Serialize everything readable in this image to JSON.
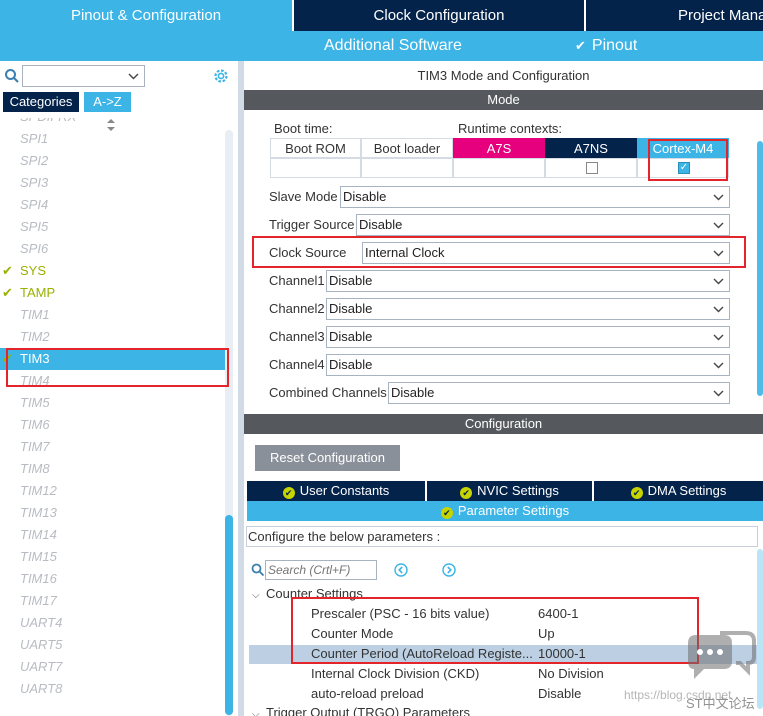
{
  "tabs": {
    "pinout": "Pinout & Configuration",
    "clock": "Clock Configuration",
    "project": "Project Mana"
  },
  "subbar": {
    "additional": "Additional Software",
    "pinout": "Pinout"
  },
  "left": {
    "search_value": "",
    "categories_tab": "Categories",
    "az_tab": "A->Z",
    "items": [
      {
        "label": "SPDIFRX",
        "state": "disabled"
      },
      {
        "label": "SPI1",
        "state": "disabled"
      },
      {
        "label": "SPI2",
        "state": "disabled"
      },
      {
        "label": "SPI3",
        "state": "disabled"
      },
      {
        "label": "SPI4",
        "state": "disabled"
      },
      {
        "label": "SPI5",
        "state": "disabled"
      },
      {
        "label": "SPI6",
        "state": "disabled"
      },
      {
        "label": "SYS",
        "state": "ok"
      },
      {
        "label": "TAMP",
        "state": "ok"
      },
      {
        "label": "TIM1",
        "state": "disabled"
      },
      {
        "label": "TIM2",
        "state": "disabled"
      },
      {
        "label": "TIM3",
        "state": "selected"
      },
      {
        "label": "TIM4",
        "state": "disabled"
      },
      {
        "label": "TIM5",
        "state": "disabled"
      },
      {
        "label": "TIM6",
        "state": "disabled"
      },
      {
        "label": "TIM7",
        "state": "disabled"
      },
      {
        "label": "TIM8",
        "state": "disabled"
      },
      {
        "label": "TIM12",
        "state": "disabled"
      },
      {
        "label": "TIM13",
        "state": "disabled"
      },
      {
        "label": "TIM14",
        "state": "disabled"
      },
      {
        "label": "TIM15",
        "state": "disabled"
      },
      {
        "label": "TIM16",
        "state": "disabled"
      },
      {
        "label": "TIM17",
        "state": "disabled"
      },
      {
        "label": "UART4",
        "state": "disabled"
      },
      {
        "label": "UART5",
        "state": "disabled"
      },
      {
        "label": "UART7",
        "state": "disabled"
      },
      {
        "label": "UART8",
        "state": "disabled"
      }
    ]
  },
  "right": {
    "title": "TIM3 Mode and Configuration",
    "mode_header": "Mode",
    "boot_time": "Boot time:",
    "runtime_contexts": "Runtime contexts:",
    "boot_rom": "Boot ROM",
    "boot_loader": "Boot loader",
    "ctx_a7s": "A7S",
    "ctx_a7ns": "A7NS",
    "ctx_m4": "Cortex-M4",
    "fields": [
      {
        "label": "Slave Mode",
        "value": "Disable"
      },
      {
        "label": "Trigger Source",
        "value": "Disable"
      },
      {
        "label": "Clock Source",
        "value": "Internal Clock"
      },
      {
        "label": "Channel1",
        "value": "Disable"
      },
      {
        "label": "Channel2",
        "value": "Disable"
      },
      {
        "label": "Channel3",
        "value": "Disable"
      },
      {
        "label": "Channel4",
        "value": "Disable"
      },
      {
        "label": "Combined Channels",
        "value": "Disable"
      }
    ],
    "config_header": "Configuration",
    "reset_button": "Reset Configuration",
    "nav": {
      "user_constants": "User Constants",
      "nvic": "NVIC Settings",
      "dma": "DMA Settings",
      "parameter": "Parameter Settings"
    },
    "configure_text": "Configure the below parameters :",
    "search_placeholder": "Search (Crtl+F)",
    "group_counter": "Counter Settings",
    "params": [
      {
        "name": "Prescaler (PSC - 16 bits value)",
        "value": "6400-1"
      },
      {
        "name": "Counter Mode",
        "value": "Up"
      },
      {
        "name": "Counter Period (AutoReload Registe...",
        "value": "10000-1"
      },
      {
        "name": "Internal Clock Division (CKD)",
        "value": "No Division"
      },
      {
        "name": "auto-reload preload",
        "value": "Disable"
      }
    ],
    "group_trgo": "Trigger Output (TRGO) Parameters"
  },
  "watermark": {
    "url": "https://blog.csdn.net",
    "brand": "ST中文论坛"
  },
  "colors": {
    "st_light_blue": "#3cb4e6",
    "st_dark_blue": "#03234b",
    "header_gray": "#55585d",
    "a7s_magenta": "#e6007e",
    "highlight_red": "#e3252b",
    "ok_green": "#9bb000"
  }
}
